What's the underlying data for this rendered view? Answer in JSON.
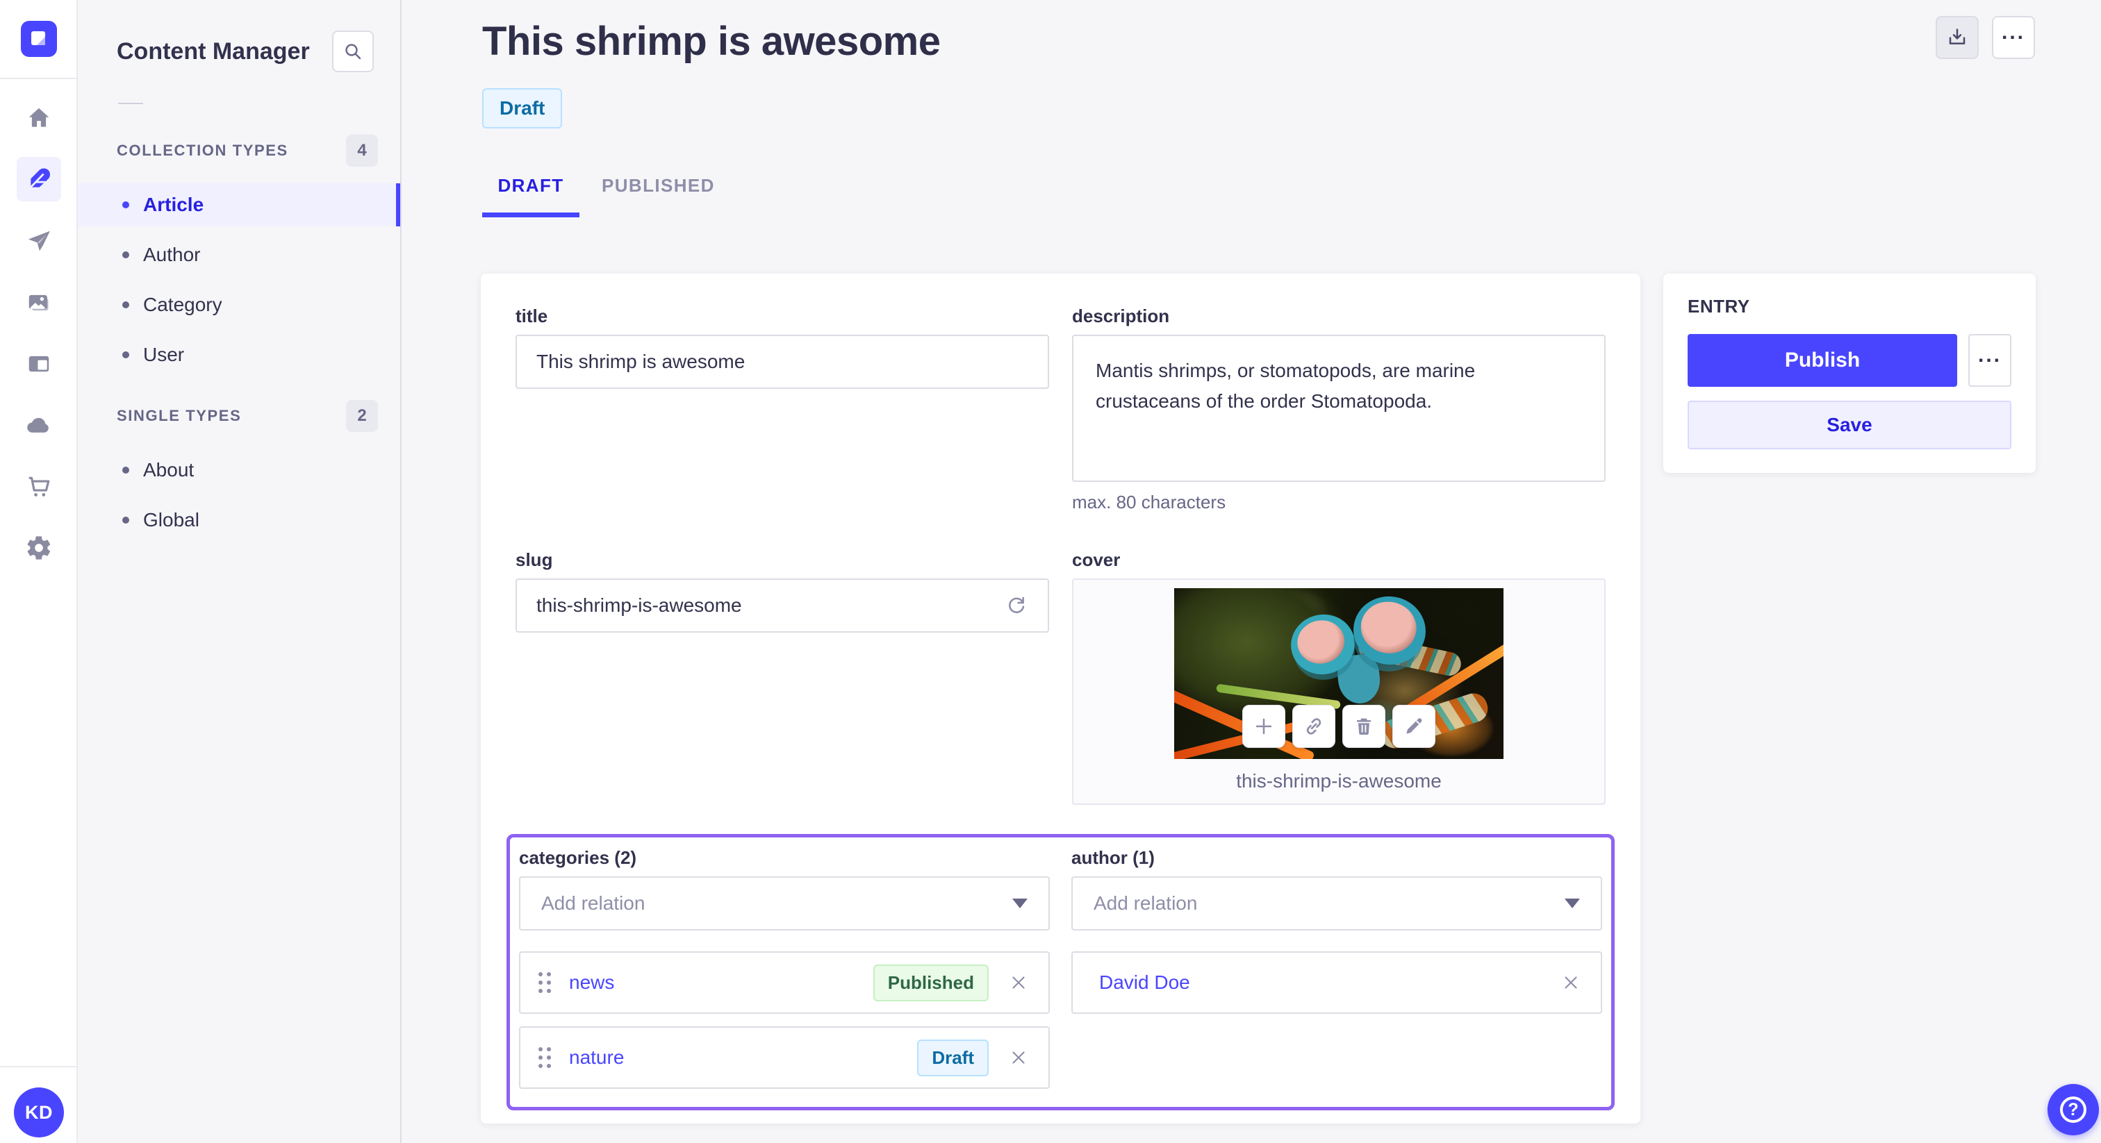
{
  "subnav": {
    "title": "Content Manager",
    "sections": [
      {
        "label": "COLLECTION TYPES",
        "count": "4",
        "items": [
          {
            "label": "Article",
            "active": true
          },
          {
            "label": "Author",
            "active": false
          },
          {
            "label": "Category",
            "active": false
          },
          {
            "label": "User",
            "active": false
          }
        ]
      },
      {
        "label": "SINGLE TYPES",
        "count": "2",
        "items": [
          {
            "label": "About",
            "active": false
          },
          {
            "label": "Global",
            "active": false
          }
        ]
      }
    ]
  },
  "header": {
    "title": "This shrimp is awesome",
    "status_badge": "Draft"
  },
  "tabs": {
    "items": [
      {
        "label": "DRAFT",
        "active": true
      },
      {
        "label": "PUBLISHED",
        "active": false
      }
    ]
  },
  "form": {
    "title": {
      "label": "title",
      "value": "This shrimp is awesome"
    },
    "description": {
      "label": "description",
      "value": "Mantis shrimps, or stomatopods, are marine crustaceans of the order Stomatopoda.",
      "hint": "max. 80 characters"
    },
    "slug": {
      "label": "slug",
      "value": "this-shrimp-is-awesome"
    },
    "cover": {
      "label": "cover",
      "caption": "this-shrimp-is-awesome"
    },
    "categories": {
      "label": "categories (2)",
      "placeholder": "Add relation",
      "items": [
        {
          "name": "news",
          "status": "Published"
        },
        {
          "name": "nature",
          "status": "Draft"
        }
      ]
    },
    "author": {
      "label": "author (1)",
      "placeholder": "Add relation",
      "items": [
        {
          "name": "David Doe"
        }
      ]
    }
  },
  "entry_panel": {
    "title": "ENTRY",
    "publish_label": "Publish",
    "save_label": "Save"
  },
  "user": {
    "initials": "KD"
  },
  "icons": {
    "rail": [
      "strapi-logo",
      "home-icon",
      "feather-icon",
      "paper-plane-icon",
      "media-icon",
      "layout-icon",
      "cloud-icon",
      "cart-icon",
      "gear-icon"
    ],
    "other": [
      "search-icon",
      "download-icon",
      "more-icon",
      "refresh-icon",
      "plus-icon",
      "link-icon",
      "trash-icon",
      "pencil-icon",
      "caret-down-icon",
      "drag-handle-icon",
      "close-icon",
      "help-icon"
    ]
  },
  "colors": {
    "primary": "#4945ff",
    "primary_dark": "#271fe0",
    "primary_bg": "#f0f0ff",
    "highlight_border": "#8f62f2",
    "draft_bg": "#eaf5ff",
    "draft_border": "#b8e1ff",
    "draft_text": "#0c6ca3",
    "published_bg": "#eafbe7",
    "published_border": "#c6f0c2",
    "published_text": "#2f6846",
    "neutral_text": "#32324d",
    "muted_text": "#666687",
    "placeholder_text": "#8e8ea9",
    "border": "#dcdce4",
    "page_bg": "#f6f6f9"
  }
}
